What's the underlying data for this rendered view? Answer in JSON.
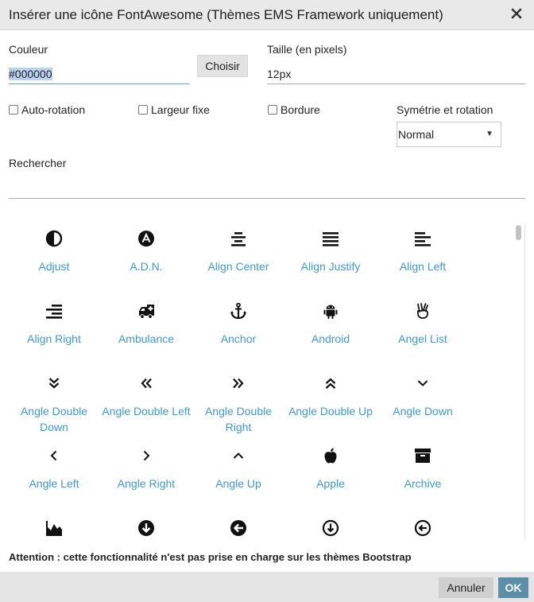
{
  "dialog": {
    "title": "Insérer une icône FontAwesome (Thèmes EMS Framework uniquement)",
    "close_icon": "close-icon"
  },
  "form": {
    "color_label": "Couleur",
    "color_value": "#000000",
    "choose_label": "Choisir",
    "size_label": "Taille (en pixels)",
    "size_value": "12px",
    "checkboxes": [
      {
        "label": "Auto-rotation",
        "checked": false
      },
      {
        "label": "Largeur fixe",
        "checked": false
      },
      {
        "label": "Bordure",
        "checked": false
      }
    ],
    "symmetry_label": "Symétrie et rotation",
    "symmetry_value": "Normal",
    "search_label": "Rechercher",
    "search_value": ""
  },
  "icons": [
    {
      "name": "Adjust",
      "icon": "adjust-icon"
    },
    {
      "name": "A.D.N.",
      "icon": "adn-icon"
    },
    {
      "name": "Align Center",
      "icon": "align-center-icon"
    },
    {
      "name": "Align Justify",
      "icon": "align-justify-icon"
    },
    {
      "name": "Align Left",
      "icon": "align-left-icon"
    },
    {
      "name": "Align Right",
      "icon": "align-right-icon"
    },
    {
      "name": "Ambulance",
      "icon": "ambulance-icon"
    },
    {
      "name": "Anchor",
      "icon": "anchor-icon"
    },
    {
      "name": "Android",
      "icon": "android-icon"
    },
    {
      "name": "Angel List",
      "icon": "angellist-icon"
    },
    {
      "name": "Angle Double Down",
      "icon": "angle-double-down-icon"
    },
    {
      "name": "Angle Double Left",
      "icon": "angle-double-left-icon"
    },
    {
      "name": "Angle Double Right",
      "icon": "angle-double-right-icon"
    },
    {
      "name": "Angle Double Up",
      "icon": "angle-double-up-icon"
    },
    {
      "name": "Angle Down",
      "icon": "angle-down-icon"
    },
    {
      "name": "Angle Left",
      "icon": "angle-left-icon"
    },
    {
      "name": "Angle Right",
      "icon": "angle-right-icon"
    },
    {
      "name": "Angle Up",
      "icon": "angle-up-icon"
    },
    {
      "name": "Apple",
      "icon": "apple-icon"
    },
    {
      "name": "Archive",
      "icon": "archive-icon"
    },
    {
      "name": "",
      "icon": "area-chart-icon"
    },
    {
      "name": "",
      "icon": "arrow-circle-down-icon"
    },
    {
      "name": "",
      "icon": "arrow-circle-left-icon"
    },
    {
      "name": "",
      "icon": "arrow-circle-o-down-icon"
    },
    {
      "name": "",
      "icon": "arrow-circle-o-left-icon"
    }
  ],
  "warning": "Attention : cette fonctionnalité n'est pas prise en charge sur les thèmes Bootstrap",
  "footer": {
    "cancel_label": "Annuler",
    "ok_label": "OK"
  }
}
